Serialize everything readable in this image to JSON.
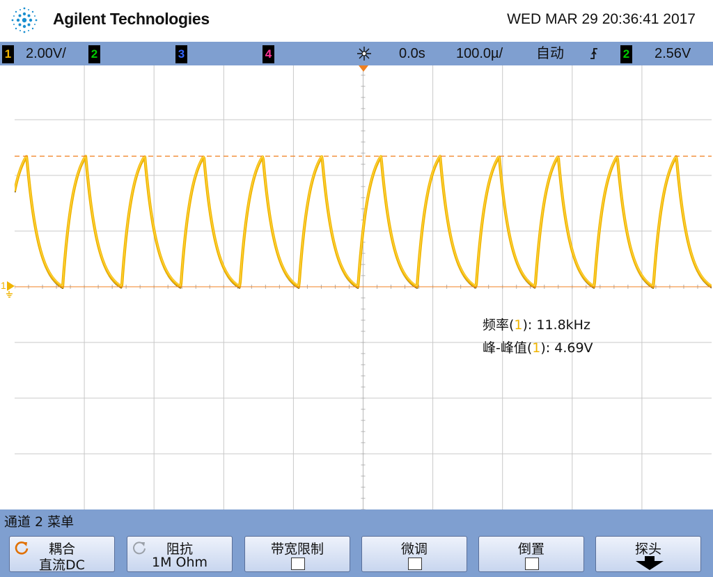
{
  "header": {
    "brand": "Agilent Technologies",
    "datetime": "WED MAR 29 20:36:41 2017"
  },
  "status_bar": {
    "ch1_label": "1",
    "ch1_scale": "2.00V/",
    "ch2_label": "2",
    "ch3_label": "3",
    "ch4_label": "4",
    "delay": "0.0s",
    "timebase": "100.0µ/",
    "trigger_mode": "自动",
    "trigger_edge_glyph": "⨍",
    "trigger_source": "2",
    "trigger_level": "2.56V"
  },
  "measurements": {
    "freq_label_prefix": "频率(",
    "freq_channel": "1",
    "freq_label_suffix": "): 11.8kHz",
    "vpp_label_prefix": "峰-峰值(",
    "vpp_channel": "1",
    "vpp_label_suffix": "): 4.69V"
  },
  "ground_marker": "1",
  "menu": {
    "title": "通道 2  菜单",
    "softkeys": [
      {
        "line1": "耦合",
        "line2": "直流DC"
      },
      {
        "line1": "阻抗",
        "line2": "1M Ohm"
      },
      {
        "line1": "带宽限制"
      },
      {
        "line1": "微调"
      },
      {
        "line1": "倒置"
      },
      {
        "line1": "探头"
      }
    ]
  },
  "colors": {
    "ch1": "#f0b400",
    "ch2": "#00cc00",
    "ch3": "#3366ff",
    "ch4": "#ff3399",
    "bar": "#7f9fd0",
    "trigger_line": "#f08020"
  },
  "chart_data": {
    "type": "line",
    "title": "",
    "xlabel": "",
    "ylabel": "",
    "grid": true,
    "x_divisions": 10,
    "y_divisions": 8,
    "volts_per_div": 2.0,
    "time_per_div_us": 100.0,
    "series": [
      {
        "waveform": "rc-charge-discharge",
        "frequency_khz": 11.8,
        "vpp_v": 4.69,
        "min_v": 0.0,
        "max_v": 4.69
      }
    ],
    "trigger_level_v": 2.56
  }
}
